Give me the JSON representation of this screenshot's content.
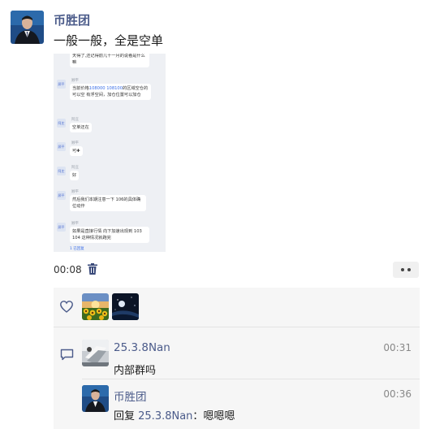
{
  "post": {
    "author": "币胜团",
    "text": "一般一般，全是空单",
    "video": {
      "duration": "00:08",
      "chat_messages": [
        {
          "sender": "",
          "text": "天得了,还记得前几十一月的说看是什么嘛"
        },
        {
          "sender": "顾平",
          "text_before": "当前价格",
          "highlight": "108000 108100",
          "text_after": "的区域空仓的可以空 有浮空间，加仓位置可以加仓"
        },
        {
          "sender": "阿庄",
          "text": "空单还在"
        },
        {
          "sender": "顾平",
          "text": "可✚"
        },
        {
          "sender": "阿庄",
          "text": "好"
        },
        {
          "sender": "顾平",
          "text": "然后我们本期注意一下 106的具体确位动作"
        },
        {
          "sender": "顾平",
          "text": "如果是直接行情 向下加速出现到 103 104 这种情况就跑完"
        }
      ],
      "chat_avatars": [
        "顾平",
        "阿庄"
      ],
      "chat_footer": "1 已回复"
    }
  },
  "likes": {
    "icon": "heart-icon",
    "likers": [
      "sunflower-avatar",
      "night-sky-avatar"
    ]
  },
  "comments": [
    {
      "name": "25.3.8Nan",
      "time": "00:31",
      "text": "内部群吗"
    },
    {
      "name": "币胜团",
      "time": "00:36",
      "reply_prefix": "回复 ",
      "reply_to": "25.3.8Nan",
      "reply_sep": "：",
      "text": "嗯嗯嗯"
    }
  ],
  "colors": {
    "name": "#4b5b8a",
    "panel": "#f6f6f6",
    "highlight": "#3a6ee8"
  }
}
